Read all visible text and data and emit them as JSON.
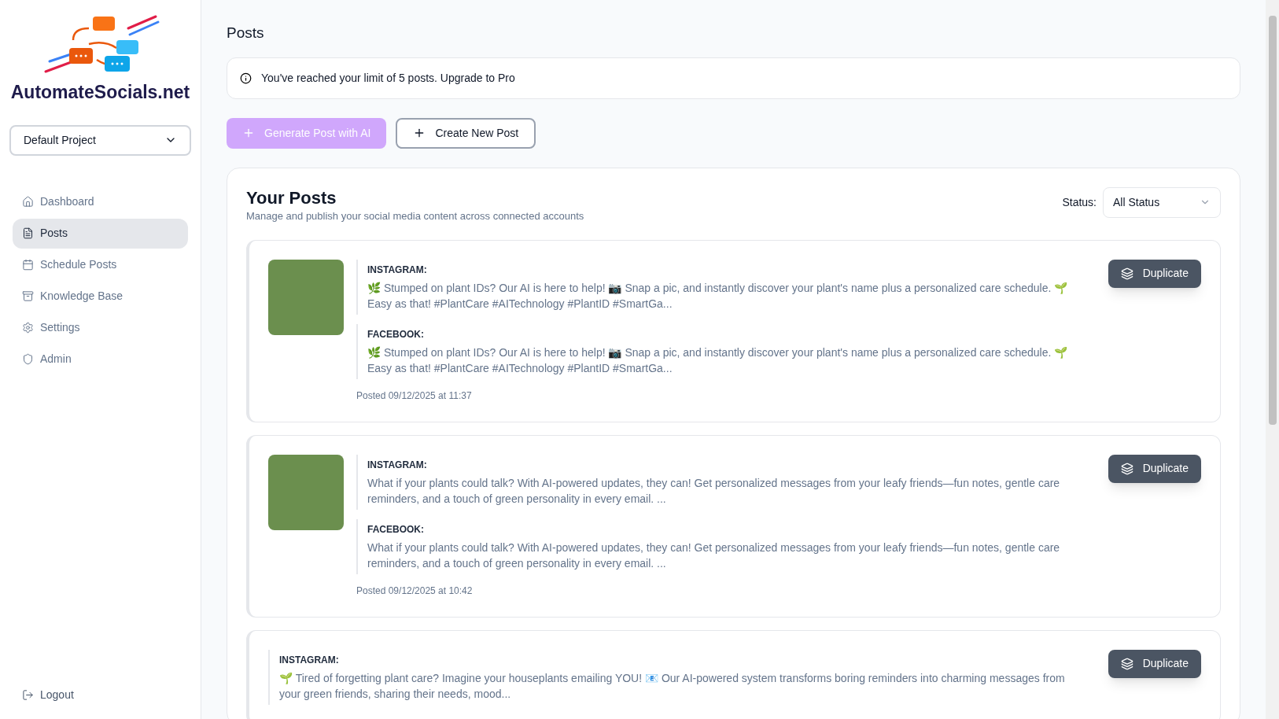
{
  "sidebar": {
    "brand": "AutomateSocials.net",
    "project": "Default Project",
    "items": [
      {
        "label": "Dashboard",
        "selected": false
      },
      {
        "label": "Posts",
        "selected": true
      },
      {
        "label": "Schedule Posts",
        "selected": false
      },
      {
        "label": "Knowledge Base",
        "selected": false
      },
      {
        "label": "Settings",
        "selected": false
      },
      {
        "label": "Admin",
        "selected": false
      }
    ],
    "logout": "Logout"
  },
  "page_title": "Posts",
  "notice": "You've reached your limit of 5 posts. Upgrade to Pro",
  "actions": [
    {
      "label": "Generate Post with AI",
      "kind": "primary",
      "disabled": true
    },
    {
      "label": "Create New Post",
      "kind": "outline",
      "disabled": false
    }
  ],
  "posts_panel": {
    "title": "Your Posts",
    "subtitle": "Manage and publish your social media content across connected accounts",
    "status_label": "Status:",
    "status_value": "All Status",
    "posts": [
      {
        "has_image": true,
        "duplicate": "Duplicate",
        "channels": [
          {
            "name": "INSTAGRAM:",
            "text": "🌿 Stumped on plant IDs? Our AI is here to help! 📷 Snap a pic, and instantly discover your plant's name plus a personalized care schedule. 🌱 Easy as that! #PlantCare #AITechnology #PlantID #SmartGa..."
          },
          {
            "name": "FACEBOOK:",
            "text": "🌿 Stumped on plant IDs? Our AI is here to help! 📷 Snap a pic, and instantly discover your plant's name plus a personalized care schedule. 🌱 Easy as that! #PlantCare #AITechnology #PlantID #SmartGa..."
          }
        ],
        "posted": "Posted 09/12/2025 at 11:37"
      },
      {
        "has_image": true,
        "duplicate": "Duplicate",
        "channels": [
          {
            "name": "INSTAGRAM:",
            "text": "What if your plants could talk? With AI-powered updates, they can! Get personalized messages from your leafy friends—fun notes, gentle care reminders, and a touch of green personality in every email. ..."
          },
          {
            "name": "FACEBOOK:",
            "text": "What if your plants could talk? With AI-powered updates, they can! Get personalized messages from your leafy friends—fun notes, gentle care reminders, and a touch of green personality in every email. ..."
          }
        ],
        "posted": "Posted 09/12/2025 at 10:42"
      },
      {
        "has_image": false,
        "duplicate": "Duplicate",
        "channels": [
          {
            "name": "INSTAGRAM:",
            "text": "🌱 Tired of forgetting plant care? Imagine your houseplants emailing YOU! 📧 Our AI-powered system transforms boring reminders into charming messages from your green friends, sharing their needs, mood..."
          }
        ]
      }
    ]
  }
}
